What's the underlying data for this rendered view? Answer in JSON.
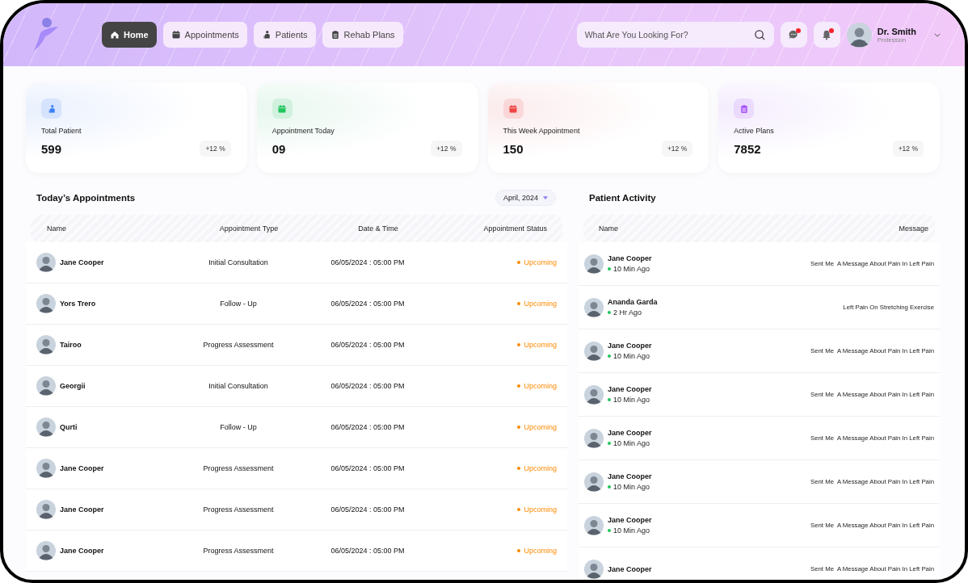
{
  "nav": [
    {
      "label": "Home",
      "selected": true
    },
    {
      "label": "Appointments",
      "selected": false
    },
    {
      "label": "Patients",
      "selected": false
    },
    {
      "label": "Rehab Plans",
      "selected": false
    }
  ],
  "search": {
    "placeholder": "What Are You Looking For?"
  },
  "notifications": [
    {
      "unread": true
    },
    {
      "unread": true
    }
  ],
  "profile": {
    "name": "Dr. Smith",
    "role": "Profession"
  },
  "stats": [
    {
      "label": "Total Patient",
      "value": "599",
      "change": "+12 %",
      "color": "#3b82f6"
    },
    {
      "label": "Appointment Today",
      "value": "09",
      "change": "+12 %",
      "color": "#22c55e"
    },
    {
      "label": "This Week Appointment",
      "value": "150",
      "change": "+12 %",
      "color": "#ef4444"
    },
    {
      "label": "Active Plans",
      "value": "7852",
      "change": "+12 %",
      "color": "#a855f7"
    }
  ],
  "appointments": {
    "title": "Today’s Appointments",
    "month": "April, 2024",
    "columns": [
      "Name",
      "Appointment Type",
      "Date & Time",
      "Appointment Status"
    ],
    "rows": [
      {
        "name": "Jane Cooper",
        "type": "Initial Consultation",
        "datetime": "06/05/2024 : 05:00 PM",
        "status": "Upcoming"
      },
      {
        "name": "Yors Trero",
        "type": "Follow - Up",
        "datetime": "06/05/2024 : 05:00 PM",
        "status": "Upcoming"
      },
      {
        "name": "Tairoo",
        "type": "Progress Assessment",
        "datetime": "06/05/2024 : 05:00 PM",
        "status": "Upcoming"
      },
      {
        "name": "Georgii",
        "type": "Initial Consultation",
        "datetime": "06/05/2024 : 05:00 PM",
        "status": "Upcoming"
      },
      {
        "name": "Qurti",
        "type": "Follow - Up",
        "datetime": "06/05/2024 : 05:00 PM",
        "status": "Upcoming"
      },
      {
        "name": "Jane Cooper",
        "type": "Progress Assessment",
        "datetime": "06/05/2024 : 05:00 PM",
        "status": "Upcoming"
      },
      {
        "name": "Jane Cooper",
        "type": "Progress Assessment",
        "datetime": "06/05/2024 : 05:00 PM",
        "status": "Upcoming"
      },
      {
        "name": "Jane Cooper",
        "type": "Progress Assessment",
        "datetime": "06/05/2024 : 05:00 PM",
        "status": "Upcoming"
      }
    ]
  },
  "activity": {
    "title": "Patient Activity",
    "columns": [
      "Name",
      "Message"
    ],
    "rows": [
      {
        "name": "Jane Cooper",
        "time": "10 Min Ago",
        "message": "Sent Me  A Message About Pain In Left Pain"
      },
      {
        "name": "Ananda Garda",
        "time": "2 Hr Ago",
        "message": "Left Pain On Stretching Exercise"
      },
      {
        "name": "Jane Cooper",
        "time": "10 Min Ago",
        "message": "Sent Me  A Message About Pain In Left Pain"
      },
      {
        "name": "Jane Cooper",
        "time": "10 Min Ago",
        "message": "Sent Me  A Message About Pain In Left Pain"
      },
      {
        "name": "Jane Cooper",
        "time": "10 Min Ago",
        "message": "Sent Me  A Message About Pain In Left Pain"
      },
      {
        "name": "Jane Cooper",
        "time": "10 Min Ago",
        "message": "Sent Me  A Message About Pain In Left Pain"
      },
      {
        "name": "Jane Cooper",
        "time": "10 Min Ago",
        "message": "Sent Me  A Message About Pain In Left Pain"
      },
      {
        "name": "Jane Cooper",
        "message": "Sent Me  A Message About Pain In Left Pain"
      }
    ]
  }
}
